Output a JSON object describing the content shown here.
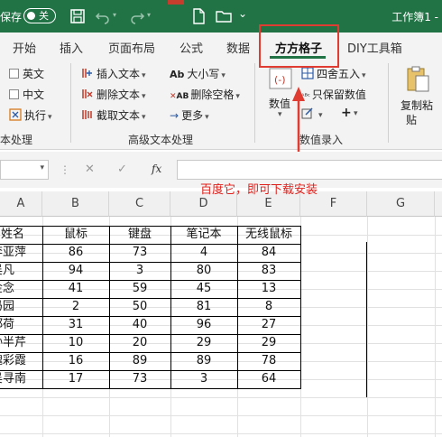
{
  "titlebar": {
    "autosave_label": "保存",
    "toggle_label": "关",
    "doc_title": "工作簿1 -"
  },
  "tabs": [
    "开始",
    "插入",
    "页面布局",
    "公式",
    "数据",
    "方方格子",
    "DIY工具箱"
  ],
  "active_tab": "方方格子",
  "ribbon": {
    "text_checks": [
      "英文",
      "中文"
    ],
    "execute_label": "执行",
    "text_processing_label": "本处理",
    "insert_text": "插入文本",
    "delete_text": "删除文本",
    "extract_text": "截取文本",
    "case_label": "大小写",
    "delete_space": "删除空格",
    "more_label": "更多",
    "advanced_text_label": "高级文本处理",
    "numeric_label": "数值",
    "round_label": "四舍五入",
    "keep_numeric": "只保留数值",
    "numeric_entry_label": "数值录入",
    "copy_paste_label_1": "复制粘",
    "copy_paste_label_2": "贴"
  },
  "formula_bar": {
    "name_box": "",
    "fx_label": "fx",
    "formula": ""
  },
  "annotation": "百度它，即可下载安装",
  "columns": [
    "A",
    "B",
    "C",
    "D",
    "E",
    "F",
    "G"
  ],
  "table": {
    "headers": [
      "姓名",
      "鼠标",
      "键盘",
      "笔记本",
      "无线鼠标"
    ],
    "rows": [
      [
        "李亚萍",
        "86",
        "73",
        "4",
        "84"
      ],
      [
        "吴凡",
        "94",
        "3",
        "80",
        "83"
      ],
      [
        "金念",
        "41",
        "59",
        "45",
        "13"
      ],
      [
        "冯园",
        "2",
        "50",
        "81",
        "8"
      ],
      [
        "郑荷",
        "31",
        "40",
        "96",
        "27"
      ],
      [
        "孙半芹",
        "10",
        "20",
        "29",
        "29"
      ],
      [
        "魏彩霞",
        "16",
        "89",
        "89",
        "78"
      ],
      [
        "吴寻南",
        "17",
        "73",
        "3",
        "64"
      ]
    ]
  },
  "colors": {
    "titlebar": "#217346",
    "annotation": "#e03c31"
  }
}
